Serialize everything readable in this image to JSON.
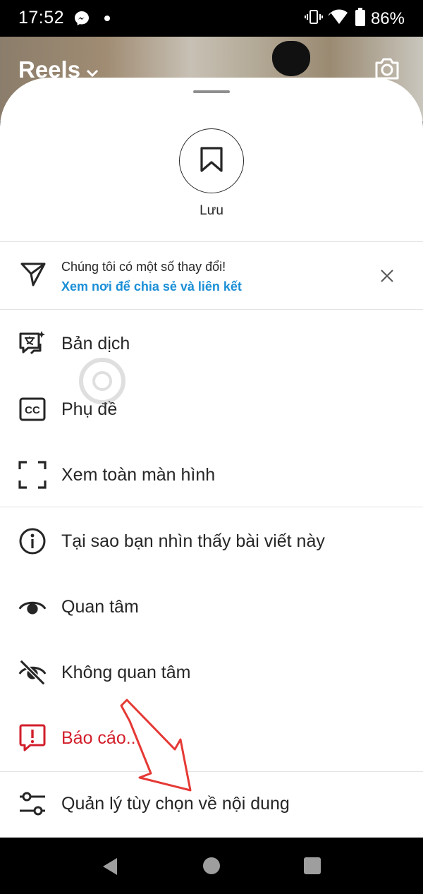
{
  "status_bar": {
    "time": "17:52",
    "battery_percent": "86%",
    "icons": [
      "messenger-icon",
      "dot-icon",
      "vibrate-icon",
      "wifi-icon",
      "battery-icon"
    ]
  },
  "header": {
    "title": "Reels",
    "icons": [
      "chevron-down-icon",
      "camera-icon"
    ]
  },
  "sheet": {
    "save_label": "Lưu",
    "notice": {
      "text": "Chúng tôi có một số thay đổi!",
      "link": "Xem nơi để chia sẻ và liên kết"
    },
    "menu": [
      {
        "label": "Bản dịch",
        "icon": "translate-icon"
      },
      {
        "label": "Phụ đề",
        "icon": "captions-icon"
      },
      {
        "label": "Xem toàn màn hình",
        "icon": "fullscreen-icon"
      },
      {
        "label": "Tại sao bạn nhìn thấy bài viết này",
        "icon": "info-icon"
      },
      {
        "label": "Quan tâm",
        "icon": "eye-icon"
      },
      {
        "label": "Không quan tâm",
        "icon": "eye-off-icon"
      },
      {
        "label": "Báo cáo...",
        "icon": "report-icon"
      },
      {
        "label": "Quản lý tùy chọn về nội dung",
        "icon": "sliders-icon"
      }
    ]
  },
  "colors": {
    "text": "#262626",
    "link": "#1a8fd6",
    "danger": "#d21f2b",
    "annotation": "#e53935"
  }
}
